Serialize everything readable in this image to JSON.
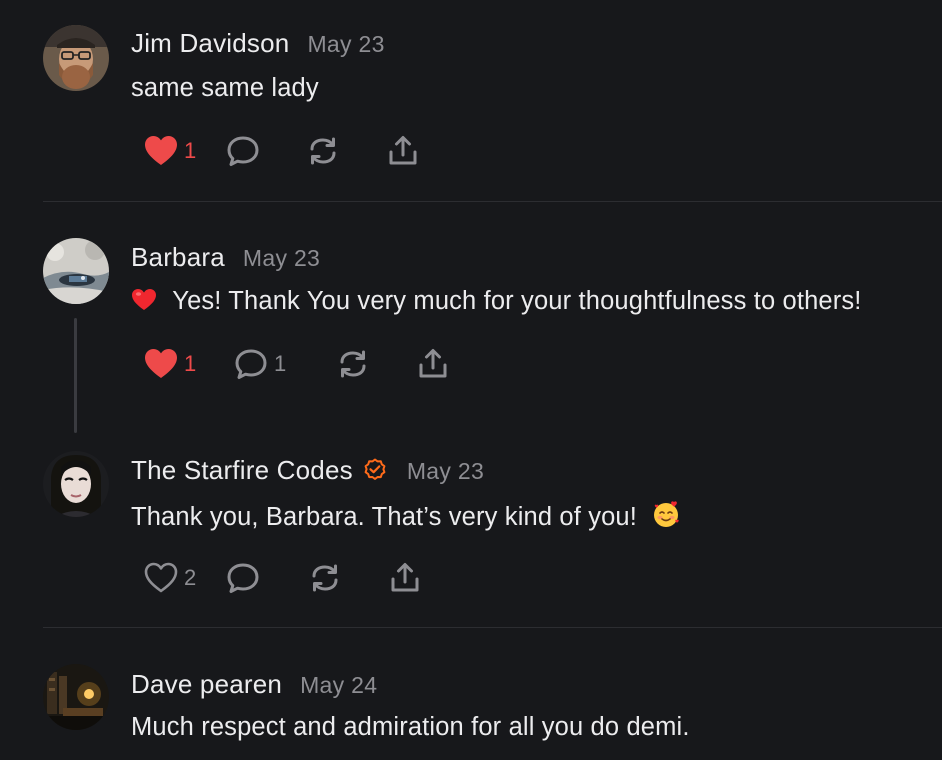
{
  "comments": [
    {
      "author": "Jim Davidson",
      "date": "May 23",
      "text": "same same lady",
      "likes": "1",
      "liked": true,
      "replies": "",
      "verified": false
    },
    {
      "author": "Barbara",
      "date": "May 23",
      "text": "Yes! Thank You very much for your thoughtfulness to others!",
      "prefix_emoji": "red-heart-emoji",
      "likes": "1",
      "liked": true,
      "replies": "1",
      "verified": false
    },
    {
      "author": "The Starfire Codes",
      "date": "May 23",
      "text": "Thank you, Barbara. That’s very kind of you!",
      "suffix_emoji": "smiling-face-with-hearts-emoji",
      "likes": "2",
      "liked": false,
      "replies": "",
      "verified": true
    },
    {
      "author": "Dave pearen",
      "date": "May 24",
      "text": "Much respect and admiration for all you do demi.",
      "verified": false
    }
  ],
  "colors": {
    "background": "#17181b",
    "text": "#ececee",
    "muted": "#8e8e93",
    "like_red": "#ee4a4a",
    "verified_orange": "#ff6b1a",
    "divider": "#2c2d31"
  }
}
